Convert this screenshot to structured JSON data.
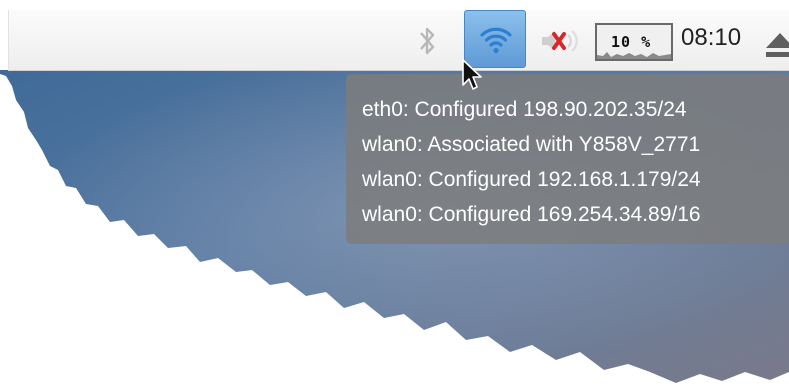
{
  "taskbar": {
    "bluetooth_icon": "bluetooth-icon",
    "network_icon": "wifi-icon",
    "volume_icon": "volume-muted-icon",
    "cpu_usage": "10 %",
    "cpu_usage_percent": 10,
    "clock": "08:10",
    "eject_icon": "eject-icon"
  },
  "network_tooltip": {
    "lines": [
      "eth0: Configured 198.90.202.35/24",
      "wlan0: Associated with Y858V_2771",
      "wlan0: Configured 192.168.1.179/24",
      "wlan0: Configured 169.254.34.89/16"
    ]
  },
  "colors": {
    "taskbar_bg": "#f4f4f4",
    "wifi_active_bg": "#6fa8dc",
    "tooltip_bg": "#7d7d7d",
    "mute_x": "#d9262b"
  }
}
